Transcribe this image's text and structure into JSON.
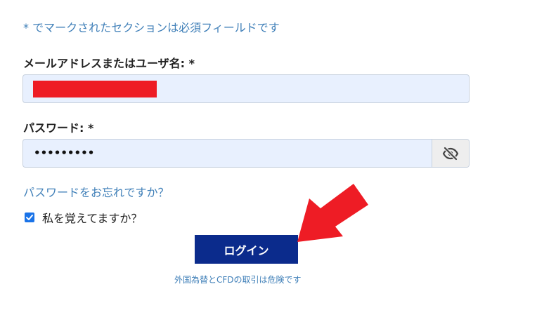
{
  "form": {
    "required_note": "* でマークされたセクションは必須フィールドです",
    "email_label": "メールアドレスまたはユーザ名: *",
    "email_value_redacted": true,
    "password_label": "パスワード: *",
    "password_value": "•••••••••",
    "password_toggle_icon": "eye-slash-icon",
    "forgot_password": "パスワードをお忘れですか？",
    "remember_me_label": "私を覚えてますか？",
    "remember_me_checked": true,
    "login_button": "ログイン",
    "risk_note": "外国為替とCFDの取引は危険です"
  },
  "colors": {
    "link_blue": "#3f7fb8",
    "input_fill": "#e8f0fe",
    "button_navy": "#0b2b8c",
    "annotation_red": "#ee1c25",
    "checkbox_blue": "#1a73e8"
  },
  "annotation": {
    "arrow_icon": "red-arrow-annotation",
    "points_to": "login-button"
  }
}
